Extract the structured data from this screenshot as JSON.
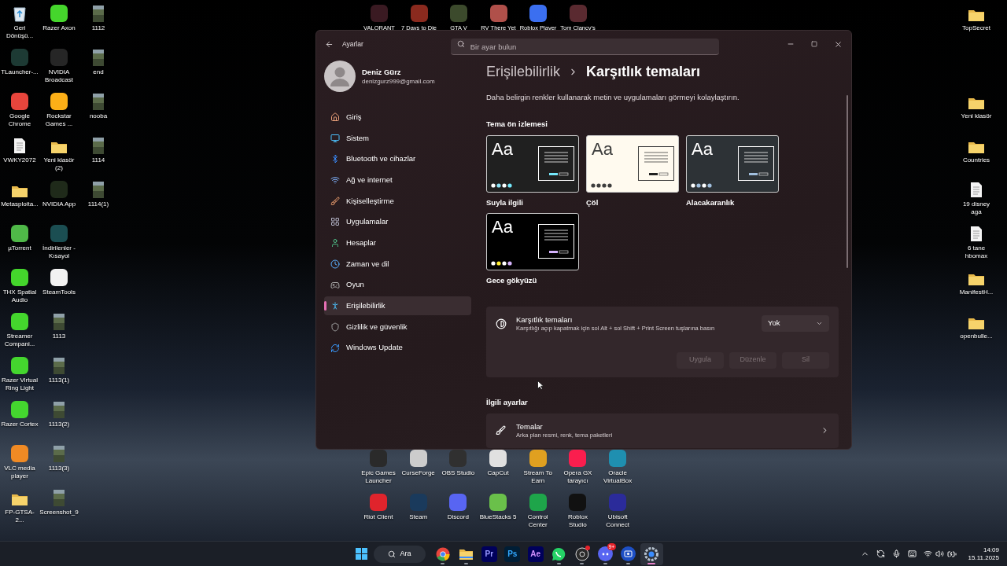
{
  "desktop": {
    "left_columns": [
      [
        {
          "label": "Geri Dönüşü...",
          "kind": "bin"
        },
        {
          "label": "TLauncher-...",
          "kind": "app",
          "color": "#1d3a34"
        },
        {
          "label": "Google Chrome",
          "kind": "app",
          "color": "#e8453c"
        },
        {
          "label": "VWKY2072",
          "kind": "file"
        },
        {
          "label": "Metasploita...",
          "kind": "folder"
        },
        {
          "label": "µTorrent",
          "kind": "app",
          "color": "#4fb848"
        },
        {
          "label": "THX Spatial Audio",
          "kind": "app",
          "color": "#44d62c"
        },
        {
          "label": "Streamer Compani...",
          "kind": "app",
          "color": "#44d62d"
        },
        {
          "label": "Razer Virtual Ring Light",
          "kind": "app",
          "color": "#44d62e"
        },
        {
          "label": "Razer Cortex",
          "kind": "app",
          "color": "#44d62f"
        },
        {
          "label": "VLC media player",
          "kind": "app",
          "color": "#f08a24"
        },
        {
          "label": "FP-GTSA-2...",
          "kind": "folder"
        }
      ],
      [
        {
          "label": "Razer Axon",
          "kind": "app",
          "color": "#45d62c"
        },
        {
          "label": "NVIDIA Broadcast",
          "kind": "app",
          "color": "#262626"
        },
        {
          "label": "Rockstar Games ...",
          "kind": "app",
          "color": "#fcaf17"
        },
        {
          "label": "Yeni klasör (2)",
          "kind": "folder"
        },
        {
          "label": "NVIDIA App",
          "kind": "app",
          "color": "#1f2a1a"
        },
        {
          "label": "İndirilenler - Kısayol",
          "kind": "app",
          "color": "#1b4e52"
        },
        {
          "label": "SteamTools",
          "kind": "app",
          "color": "#f2f2f2"
        },
        {
          "label": "1113",
          "kind": "image"
        },
        {
          "label": "1113(1)",
          "kind": "image"
        },
        {
          "label": "1113(2)",
          "kind": "image"
        },
        {
          "label": "1113(3)",
          "kind": "image"
        },
        {
          "label": "Screenshot_9",
          "kind": "image"
        }
      ],
      [
        {
          "label": "1112",
          "kind": "image"
        },
        {
          "label": "end",
          "kind": "image"
        },
        {
          "label": "nooba",
          "kind": "image"
        },
        {
          "label": "1114",
          "kind": "image"
        },
        {
          "label": "1114(1)",
          "kind": "image"
        }
      ]
    ],
    "top_row": [
      {
        "label": "VALORANT",
        "kind": "app",
        "color": "#3a1a22"
      },
      {
        "label": "7 Days to Die",
        "kind": "app",
        "color": "#8a2a1e"
      },
      {
        "label": "GTA V",
        "kind": "app",
        "color": "#3c4a2c"
      },
      {
        "label": "RV There Yet",
        "kind": "app",
        "color": "#b0504a"
      },
      {
        "label": "Roblox Player",
        "kind": "app",
        "color": "#3b6ff0"
      },
      {
        "label": "Tom Clancy's",
        "kind": "app",
        "color": "#5a2a30"
      }
    ],
    "bottom_rows": [
      [
        {
          "label": "Epic Games Launcher",
          "kind": "app",
          "color": "#2a2a2a"
        },
        {
          "label": "CurseForge",
          "kind": "app",
          "color": "#cccccc"
        },
        {
          "label": "OBS Studio",
          "kind": "app",
          "color": "#303030"
        },
        {
          "label": "CapCut",
          "kind": "app",
          "color": "#e0e0e0"
        },
        {
          "label": "Stream To Earn",
          "kind": "app",
          "color": "#e0a020"
        },
        {
          "label": "Opera GX tarayıcı",
          "kind": "app",
          "color": "#fa1e4e"
        },
        {
          "label": "Oracle VirtualBox",
          "kind": "app",
          "color": "#1f8fb0"
        }
      ],
      [
        {
          "label": "Riot Client",
          "kind": "app",
          "color": "#e0242c"
        },
        {
          "label": "Steam",
          "kind": "app",
          "color": "#1a3a5c"
        },
        {
          "label": "Discord",
          "kind": "app",
          "color": "#5865f2"
        },
        {
          "label": "BlueStacks 5",
          "kind": "app",
          "color": "#6ac04a"
        },
        {
          "label": "Control Center",
          "kind": "app",
          "color": "#1ea54a"
        },
        {
          "label": "Roblox Studio",
          "kind": "app",
          "color": "#111111"
        },
        {
          "label": "Ubisoft Connect",
          "kind": "app",
          "color": "#2b2b9a"
        }
      ]
    ],
    "right_top": [
      {
        "label": "TopSecret",
        "kind": "folder"
      }
    ],
    "right_column": [
      {
        "label": "Yeni klasör",
        "kind": "folder"
      },
      {
        "label": "Countries",
        "kind": "folder"
      },
      {
        "label": "19 disney aga",
        "kind": "file"
      },
      {
        "label": "6 tane hbomax",
        "kind": "file"
      },
      {
        "label": "ManifestH...",
        "kind": "folder"
      },
      {
        "label": "openbulle...",
        "kind": "folder"
      }
    ]
  },
  "settings": {
    "title": "Ayarlar",
    "search": {
      "placeholder": "Bir ayar bulun"
    },
    "profile": {
      "name": "Deniz Gürz",
      "email": "denizgurz999@gmail.com"
    },
    "nav": [
      {
        "label": "Giriş",
        "selected": false
      },
      {
        "label": "Sistem",
        "selected": false
      },
      {
        "label": "Bluetooth ve cihazlar",
        "selected": false
      },
      {
        "label": "Ağ ve internet",
        "selected": false
      },
      {
        "label": "Kişiselleştirme",
        "selected": false
      },
      {
        "label": "Uygulamalar",
        "selected": false
      },
      {
        "label": "Hesaplar",
        "selected": false
      },
      {
        "label": "Zaman ve dil",
        "selected": false
      },
      {
        "label": "Oyun",
        "selected": false
      },
      {
        "label": "Erişilebilirlik",
        "selected": true
      },
      {
        "label": "Gizlilik ve güvenlik",
        "selected": false
      },
      {
        "label": "Windows Update",
        "selected": false
      }
    ],
    "breadcrumb": {
      "parent": "Erişilebilirlik",
      "current": "Karşıtlık temaları"
    },
    "description": "Daha belirgin renkler kullanarak metin ve uygulamaları görmeyi kolaylaştırın.",
    "preview_heading": "Tema ön izlemesi",
    "themes": [
      {
        "name": "Suyla ilgili",
        "kind": "aquatic",
        "sample": "Aa"
      },
      {
        "name": "Çöl",
        "kind": "desert",
        "sample": "Aa"
      },
      {
        "name": "Alacakaranlık",
        "kind": "dusk",
        "sample": "Aa"
      },
      {
        "name": "Gece gökyüzü",
        "kind": "night",
        "sample": "Aa"
      }
    ],
    "contrast": {
      "title": "Karşıtlık temaları",
      "subtitle": "Karşıtlığı açıp kapatmak için sol Alt + sol Shift + Print Screen tuşlarına basın",
      "dropdown": {
        "value": "Yok"
      },
      "buttons": [
        {
          "label": "Uygula",
          "disabled": true
        },
        {
          "label": "Düzenle",
          "disabled": true
        },
        {
          "label": "Sil",
          "disabled": true
        }
      ]
    },
    "related": {
      "heading": "İlgili ayarlar",
      "items": [
        {
          "title": "Temalar",
          "subtitle": "Arka plan resmi, renk, tema paketleri"
        }
      ]
    }
  },
  "taskbar": {
    "search": "Ara",
    "apps": [
      {
        "kind": "browser",
        "running": true,
        "active": false
      },
      {
        "kind": "files",
        "running": true,
        "active": false
      },
      {
        "kind": "pr",
        "label": "Pr",
        "running": false,
        "active": false
      },
      {
        "kind": "ps",
        "label": "Ps",
        "running": false,
        "active": false
      },
      {
        "kind": "ae",
        "label": "Ae",
        "running": false,
        "active": false
      },
      {
        "kind": "chat",
        "running": true,
        "active": false
      },
      {
        "kind": "recorder",
        "running": true,
        "active": false,
        "dot": true
      },
      {
        "kind": "discord",
        "running": true,
        "active": false,
        "badge": "9+"
      },
      {
        "kind": "capture",
        "running": true,
        "active": false
      },
      {
        "kind": "settings",
        "running": true,
        "active": true
      }
    ],
    "clock": {
      "time": "14:09",
      "date": "15.11.2025"
    }
  }
}
